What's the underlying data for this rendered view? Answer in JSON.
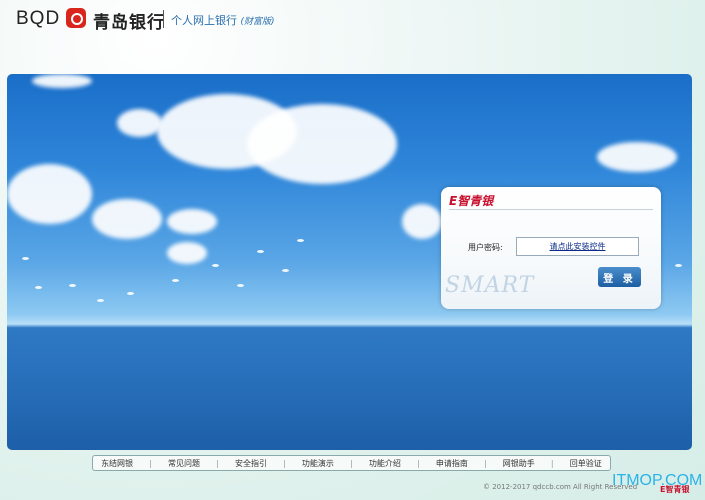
{
  "header": {
    "bqd": "BQD",
    "bank_name": "青岛银行",
    "subtitle": "个人网上银行",
    "edition": "(财富版)"
  },
  "login": {
    "brand": "E智青银",
    "password_label": "用户密码:",
    "install_link": "请点此安装控件",
    "login_button": "登 录",
    "watermark": "SMART"
  },
  "footer": {
    "links": [
      "东结网银",
      "常见问题",
      "安全指引",
      "功能演示",
      "功能介绍",
      "申请指南",
      "网银助手",
      "回单验证"
    ],
    "copyright": "© 2012-2017 qdccb.com All Right Reserved",
    "watermark": "ITMOP.COM",
    "mini_logo": "E智青银"
  }
}
